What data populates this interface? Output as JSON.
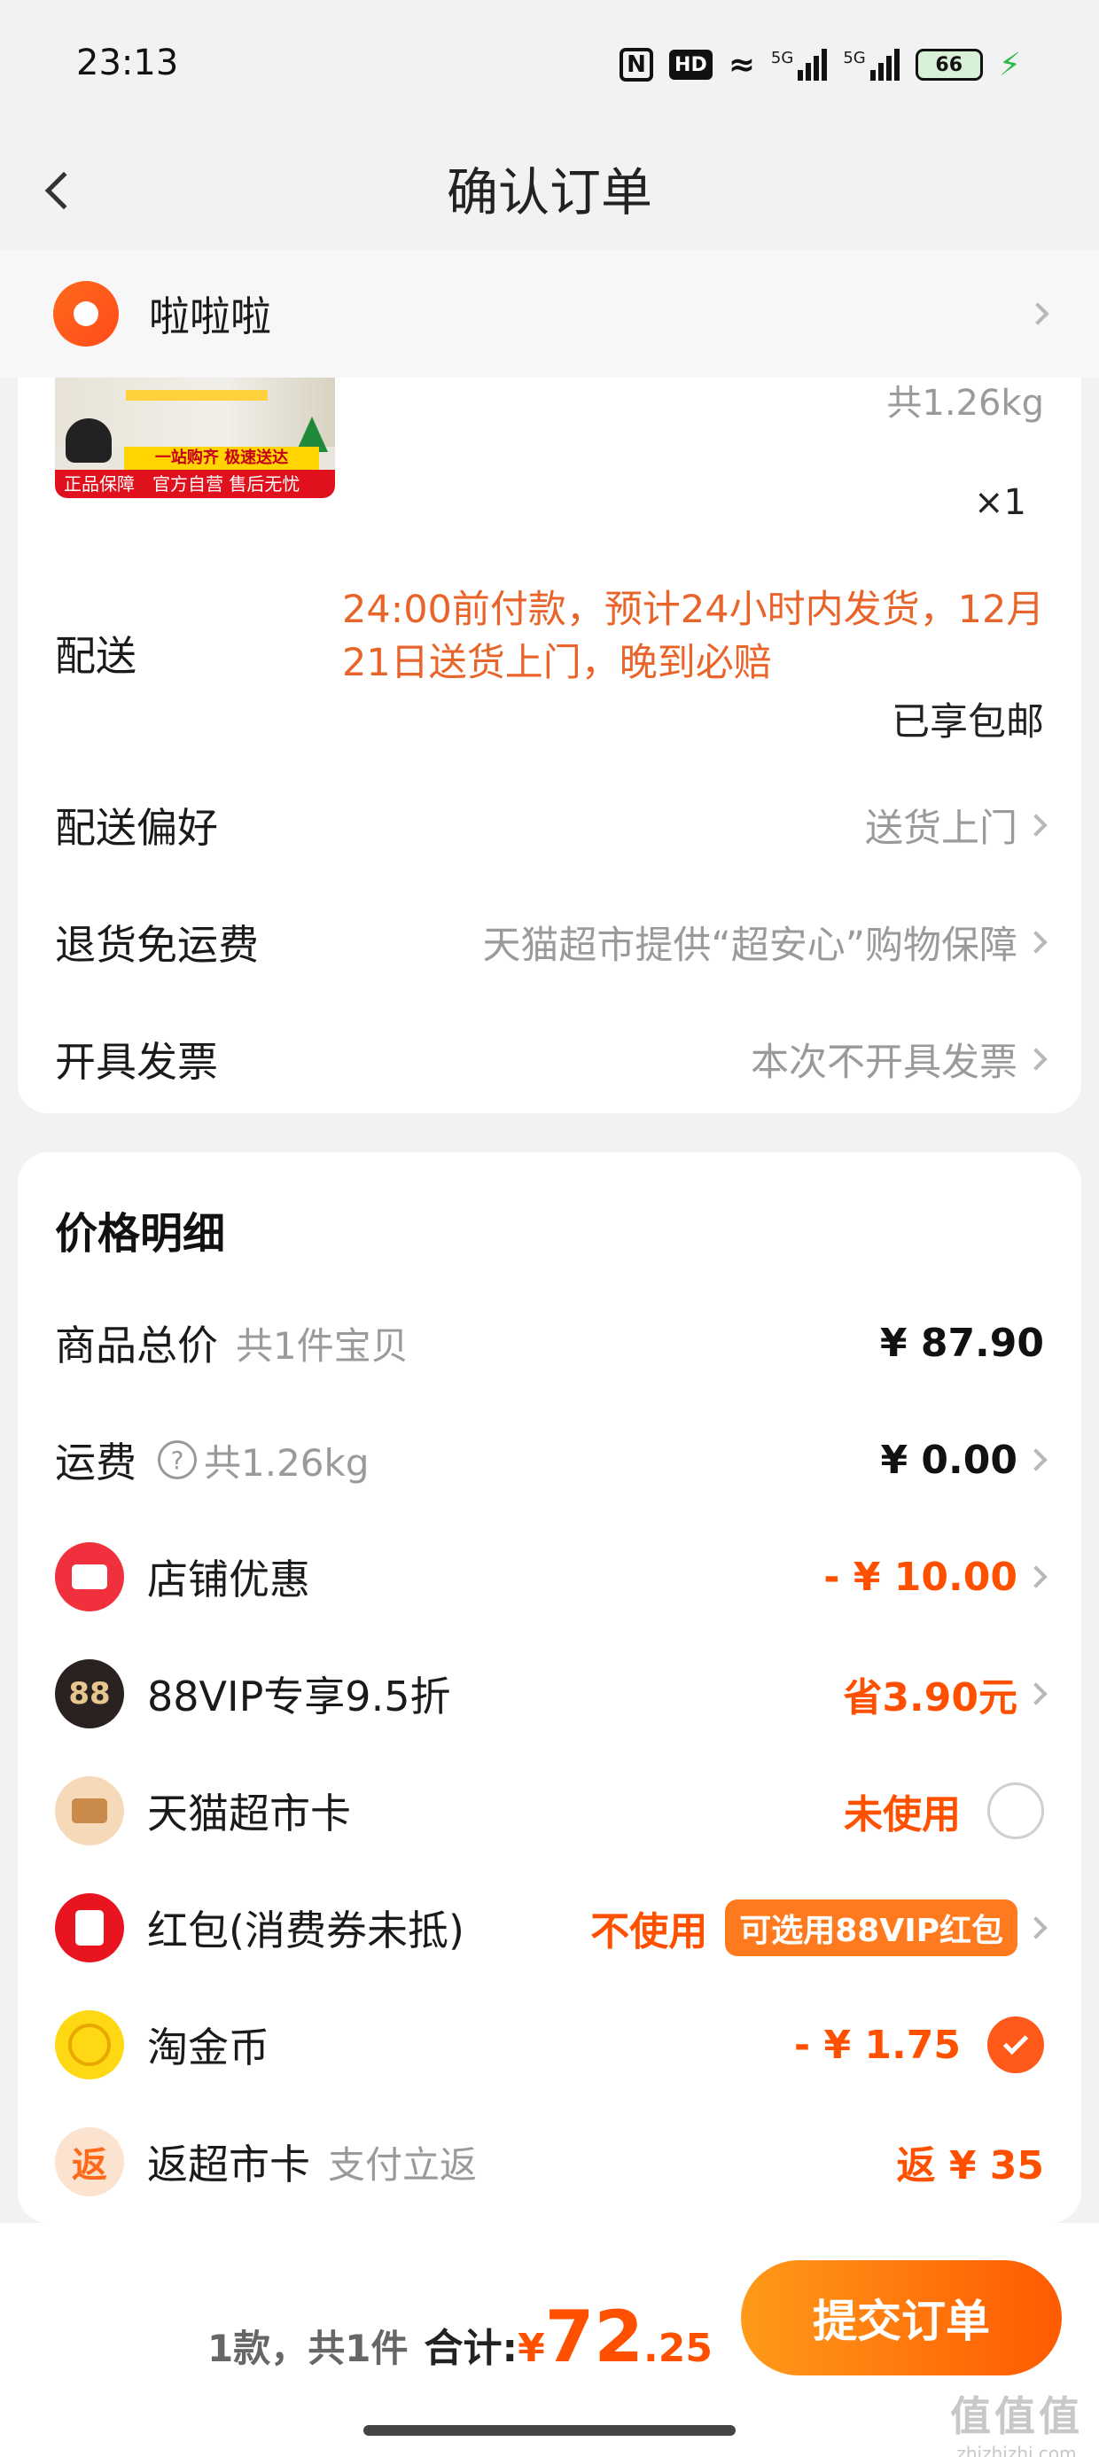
{
  "status_bar": {
    "time": "23:13",
    "network": "5G",
    "battery": "66"
  },
  "header": {
    "title": "确认订单"
  },
  "address": {
    "name": "啦啦啦"
  },
  "product": {
    "weight": "共1.26kg",
    "qty": "×1",
    "image_text": {
      "promo": "一站购齐 极速送达",
      "guarantee": "正品保障",
      "official": "官方自营 售后无忧"
    }
  },
  "delivery": {
    "label": "配送",
    "note": "24:00前付款，预计24小时内发货，12月21日送货上门，晚到必赔",
    "free_shipping": "已享包邮"
  },
  "preference": {
    "label": "配送偏好",
    "value": "送货上门"
  },
  "returns": {
    "label": "退货免运费",
    "value": "天猫超市提供“超安心”购物保障"
  },
  "invoice": {
    "label": "开具发票",
    "value": "本次不开具发票"
  },
  "price": {
    "title": "价格明细",
    "goods_total": {
      "label": "商品总价",
      "sub": "共1件宝贝",
      "value": "¥ 87.90"
    },
    "shipping": {
      "label": "运费",
      "sub": "共1.26kg",
      "value": "¥ 0.00"
    },
    "shop_discount": {
      "label": "店铺优惠",
      "value": "- ¥ 10.00"
    },
    "vip": {
      "label": "88VIP专享9.5折",
      "icon_text": "88",
      "value": "省3.90元"
    },
    "card": {
      "label": "天猫超市卡",
      "value": "未使用"
    },
    "redpacket": {
      "label": "红包(消费券未抵)",
      "value": "不使用",
      "tag": "可选用88VIP红包"
    },
    "coins": {
      "label": "淘金币",
      "value": "- ¥ 1.75"
    },
    "rebate": {
      "label": "返超市卡",
      "icon_text": "返",
      "sub": "支付立返",
      "value": "返 ¥ 35"
    }
  },
  "footer": {
    "count": "1款，共1件",
    "total_label": "合计:",
    "currency": "¥",
    "total_int": "72",
    "total_dec": ".25",
    "submit": "提交订单"
  },
  "watermark": {
    "logo": "值值值",
    "site": "zhizhizhi.com"
  },
  "colors": {
    "accent": "#ff5000",
    "delivery_note": "#e8642a",
    "button_start": "#ff9a1a",
    "button_end": "#ff5a00"
  }
}
